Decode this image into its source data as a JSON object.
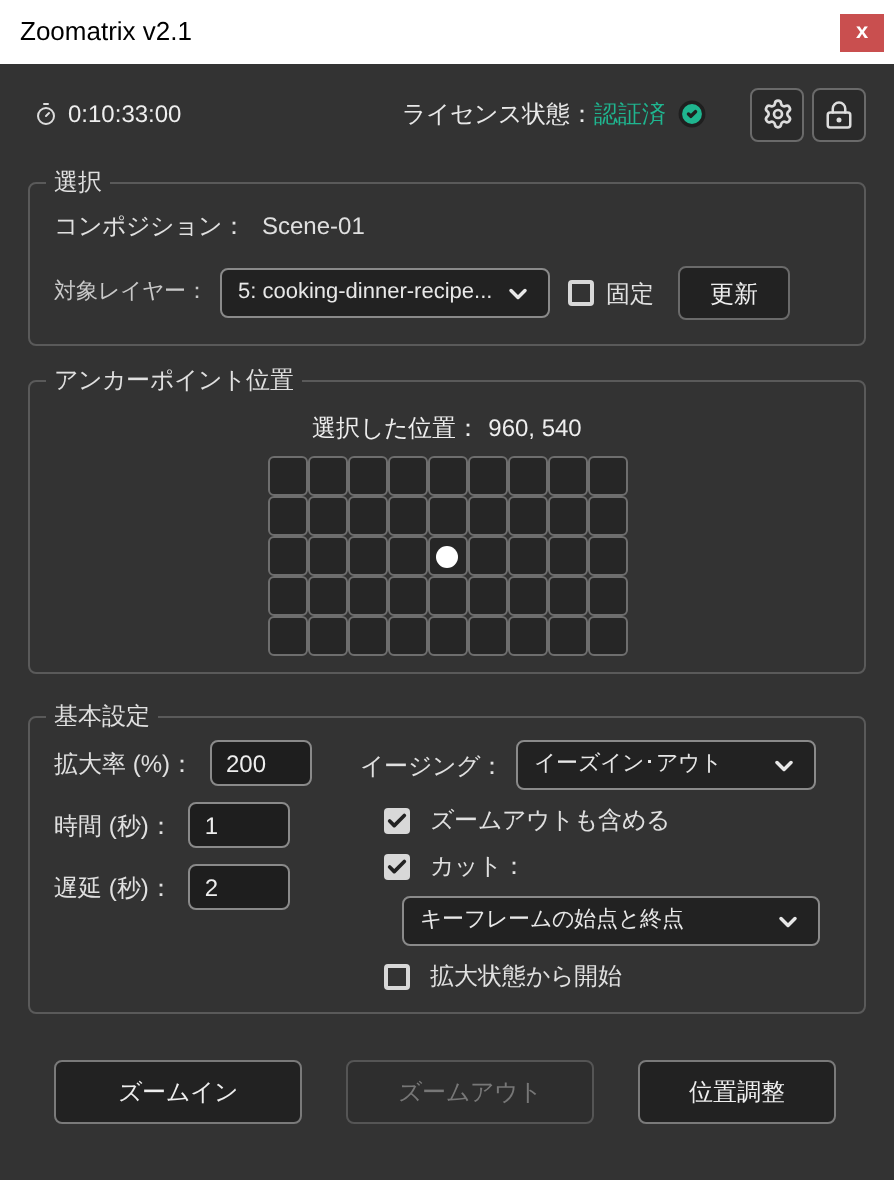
{
  "window": {
    "title": "Zoomatrix v2.1",
    "close": "x"
  },
  "header": {
    "timer": "0:10:33:00",
    "license_label": "ライセンス状態：",
    "license_status": "認証済",
    "verified": true
  },
  "selection": {
    "legend": "選択",
    "composition_label": "コンポジション：",
    "composition": "Scene-01",
    "layer_label": "対象レイヤー：",
    "layer": "5: cooking-dinner-recipe...",
    "lock": {
      "label": "固定",
      "checked": false
    },
    "refresh": "更新"
  },
  "anchor": {
    "legend": "アンカーポイント位置",
    "selected_label": "選択した位置：",
    "selected_value": "960, 540",
    "rows": [
      [
        {
          "selected": false
        },
        {
          "selected": false
        },
        {
          "selected": false
        },
        {
          "selected": false
        },
        {
          "selected": false
        },
        {
          "selected": false
        },
        {
          "selected": false
        },
        {
          "selected": false
        },
        {
          "selected": false
        }
      ],
      [
        {
          "selected": false
        },
        {
          "selected": false
        },
        {
          "selected": false
        },
        {
          "selected": false
        },
        {
          "selected": false
        },
        {
          "selected": false
        },
        {
          "selected": false
        },
        {
          "selected": false
        },
        {
          "selected": false
        }
      ],
      [
        {
          "selected": false
        },
        {
          "selected": false
        },
        {
          "selected": false
        },
        {
          "selected": false
        },
        {
          "selected": true
        },
        {
          "selected": false
        },
        {
          "selected": false
        },
        {
          "selected": false
        },
        {
          "selected": false
        }
      ],
      [
        {
          "selected": false
        },
        {
          "selected": false
        },
        {
          "selected": false
        },
        {
          "selected": false
        },
        {
          "selected": false
        },
        {
          "selected": false
        },
        {
          "selected": false
        },
        {
          "selected": false
        },
        {
          "selected": false
        }
      ],
      [
        {
          "selected": false
        },
        {
          "selected": false
        },
        {
          "selected": false
        },
        {
          "selected": false
        },
        {
          "selected": false
        },
        {
          "selected": false
        },
        {
          "selected": false
        },
        {
          "selected": false
        },
        {
          "selected": false
        }
      ]
    ]
  },
  "settings": {
    "legend": "基本設定",
    "fields": [
      {
        "label": "拡大率 (%)：",
        "value": "200"
      },
      {
        "label": "時間 (秒)：",
        "value": "1"
      },
      {
        "label": "遅延 (秒)：",
        "value": "2"
      }
    ],
    "easing_label": "イージング：",
    "easing": "イーズイン･アウト",
    "options": [
      {
        "kind": "checkbox",
        "label": "ズームアウトも含める",
        "checked": true
      },
      {
        "kind": "checkbox",
        "label": "カット：",
        "checked": true
      },
      {
        "kind": "select",
        "value": "キーフレームの始点と終点"
      },
      {
        "kind": "checkbox",
        "label": "拡大状態から開始",
        "checked": false
      }
    ]
  },
  "buttons": [
    {
      "label": "ズームイン",
      "disabled": false
    },
    {
      "label": "ズームアウト",
      "disabled": true
    },
    {
      "label": "位置調整",
      "disabled": false
    }
  ]
}
